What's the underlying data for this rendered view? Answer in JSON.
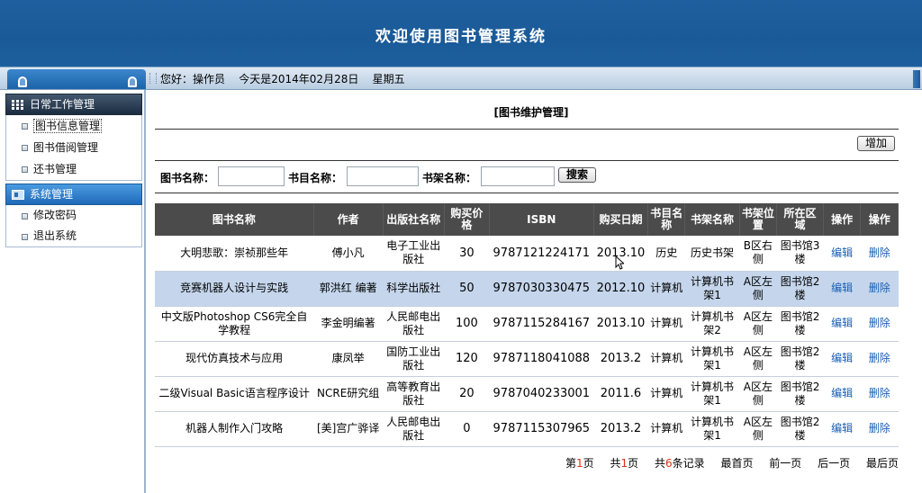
{
  "header": {
    "title": "欢迎使用图书管理系统"
  },
  "topbar": {
    "greeting": "您好：操作员    今天是2014年02月28日    星期五"
  },
  "sidebar": {
    "sections": [
      {
        "title": "日常工作管理",
        "items": [
          "图书信息管理",
          "图书借阅管理",
          "还书管理"
        ]
      },
      {
        "title": "系统管理",
        "items": [
          "修改密码",
          "退出系统"
        ]
      }
    ]
  },
  "main": {
    "page_title": "[图书维护管理]",
    "add_label": "增加",
    "search": {
      "book_name_label": "图书名称：",
      "catalog_name_label": "书目名称：",
      "shelf_name_label": "书架名称：",
      "button_label": "搜索"
    },
    "table": {
      "columns": [
        "图书名称",
        "作者",
        "出版社名称",
        "购买价格",
        "ISBN",
        "购买日期",
        "书目名称",
        "书架名称",
        "书架位置",
        "所在区域",
        "操作",
        "操作"
      ],
      "rows": [
        [
          "大明悲歌：崇祯那些年",
          "傅小凡",
          "电子工业出版社",
          "30",
          "9787121224171",
          "2013.10",
          "历史",
          "历史书架",
          "B区右侧",
          "图书馆3楼",
          "编辑",
          "删除"
        ],
        [
          "竞赛机器人设计与实践",
          "郭洪红 编著",
          "科学出版社",
          "50",
          "9787030330475",
          "2012.10",
          "计算机",
          "计算机书架1",
          "A区左侧",
          "图书馆2楼",
          "编辑",
          "删除"
        ],
        [
          "中文版Photoshop CS6完全自学教程",
          "李金明编著",
          "人民邮电出版社",
          "100",
          "9787115284167",
          "2013.10",
          "计算机",
          "计算机书架2",
          "A区左侧",
          "图书馆2楼",
          "编辑",
          "删除"
        ],
        [
          "现代仿真技术与应用",
          "康凤举",
          "国防工业出版社",
          "120",
          "9787118041088",
          "2013.2",
          "计算机",
          "计算机书架1",
          "A区左侧",
          "图书馆2楼",
          "编辑",
          "删除"
        ],
        [
          "二级Visual Basic语言程序设计",
          "NCRE研究组",
          "高等教育出版社",
          "20",
          "9787040233001",
          "2011.6",
          "计算机",
          "计算机书架1",
          "A区左侧",
          "图书馆2楼",
          "编辑",
          "删除"
        ],
        [
          "机器人制作入门攻略",
          "[美]宫广骅译",
          "人民邮电出版社",
          "0",
          "9787115307965",
          "2013.2",
          "计算机",
          "计算机书架1",
          "A区左侧",
          "图书馆2楼",
          "编辑",
          "删除"
        ]
      ]
    },
    "pager": {
      "page_prefix": "第",
      "page_num": "1",
      "page_suffix": "页",
      "total_prefix": "共",
      "total_pages": "1",
      "total_suffix": "页",
      "records_prefix": "共",
      "records": "6",
      "records_suffix": "条记录",
      "first": "最首页",
      "prev": "前一页",
      "next": "后一页",
      "last": "最后页"
    }
  },
  "colors": {
    "header_bg": "#1a5a98",
    "table_header_bg": "#4b4b4b",
    "highlight_row": "#c5d6ec",
    "link": "#1a5fb4",
    "pager_number": "#e03010"
  }
}
